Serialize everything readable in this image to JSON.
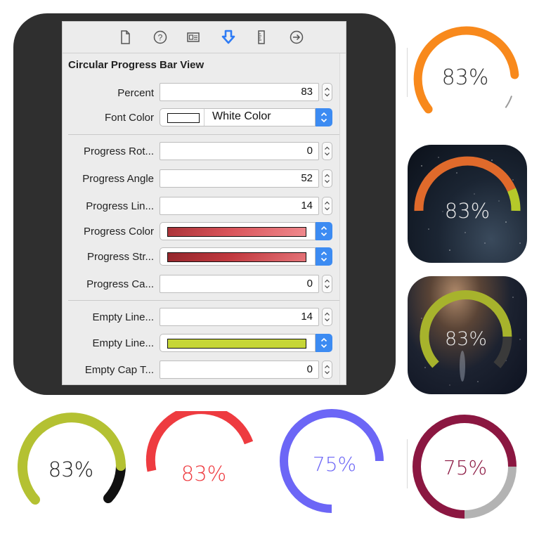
{
  "inspector": {
    "section_title": "Circular Progress Bar View",
    "toolbar_icons": [
      "file-icon",
      "help-icon",
      "identity-icon",
      "attributes-icon",
      "size-ruler-icon",
      "connections-icon"
    ],
    "rows": [
      {
        "label": "Percent",
        "value": "83"
      },
      {
        "label": "Font Color",
        "value": "White Color",
        "swatch": "#ffffff"
      },
      {
        "label": "Progress Rot...",
        "value": "0"
      },
      {
        "label": "Progress Angle",
        "value": "52"
      },
      {
        "label": "Progress Lin...",
        "value": "14"
      },
      {
        "label": "Progress Color",
        "swatch": "#d9545a"
      },
      {
        "label": "Progress Str...",
        "swatch": "#c1393f"
      },
      {
        "label": "Progress Ca...",
        "value": "0"
      },
      {
        "label": "Empty Line...",
        "value": "14"
      },
      {
        "label": "Empty Line...",
        "swatch": "#c6d637"
      },
      {
        "label": "Empty Cap T...",
        "value": "0"
      }
    ]
  },
  "samples": [
    {
      "label": "83%",
      "percent": 83,
      "color": "#f8891c",
      "track": "#9a9a9a",
      "text": "#333333"
    },
    {
      "label": "83%",
      "percent": 83,
      "color": "#e06a2b",
      "track": "#b5c92a",
      "text": "#e8e8e8"
    },
    {
      "label": "83%",
      "percent": 83,
      "color": "#a7b32c",
      "track": "#3a3a3a",
      "text": "#e8e8e8"
    },
    {
      "label": "83%",
      "percent": 83,
      "color": "#b4c132",
      "track": "#111111",
      "text": "#222222"
    },
    {
      "label": "83%",
      "percent": 83,
      "color": "#ee3b40",
      "track": "none",
      "text": "#ee3b40"
    },
    {
      "label": "75%",
      "percent": 75,
      "color": "#6c66f6",
      "track": "none",
      "text": "#6c66f6"
    },
    {
      "label": "75%",
      "percent": 75,
      "color": "#8b1741",
      "track": "#b3b3b3",
      "text": "#8b1741"
    }
  ],
  "colors": {
    "accent_blue": "#3c8bf2",
    "panel_dark": "#2f2f2f"
  }
}
